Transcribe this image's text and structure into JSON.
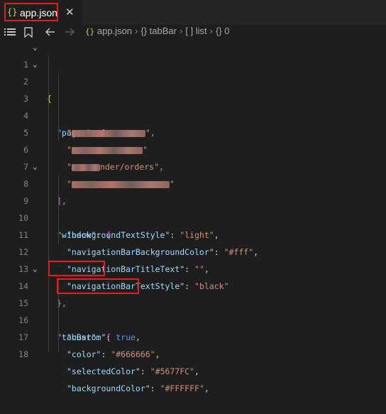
{
  "tab": {
    "icon": "json-braces-icon",
    "braces": "{}",
    "title": "app.json",
    "close_glyph": "✕"
  },
  "breadcrumb": {
    "file_icon": "{}",
    "file": "app.json",
    "items": [
      "{} tabBar",
      "[ ] list",
      "{} 0"
    ]
  },
  "lines": [
    {
      "n": "1"
    },
    {
      "n": "2"
    },
    {
      "n": "3"
    },
    {
      "n": "4"
    },
    {
      "n": "5"
    },
    {
      "n": "6"
    },
    {
      "n": "7"
    },
    {
      "n": "8"
    },
    {
      "n": "9"
    },
    {
      "n": "10"
    },
    {
      "n": "11"
    },
    {
      "n": "12"
    },
    {
      "n": "13"
    },
    {
      "n": "14"
    },
    {
      "n": "15"
    },
    {
      "n": "16"
    },
    {
      "n": "17"
    },
    {
      "n": "18"
    }
  ],
  "code": {
    "open_brace": "{",
    "pages_key": "\"pages\"",
    "pages_open": "[",
    "page4_tail": "nder/orders\",",
    "pages_close": "],",
    "window_key": "\"window\"",
    "window_open": "{",
    "bts_key": "\"backgroundTextStyle\"",
    "bts_val": "\"light\"",
    "nbbc_key": "\"navigationBarBackgroundColor\"",
    "nbbc_val": "\"#fff\"",
    "nbtt_key": "\"navigationBarTitleText\"",
    "nbtt_val": "\"\"",
    "nbts_key": "\"navigationBarTextStyle\"",
    "nbts_val": "\"black\"",
    "window_close": "},",
    "tabbar_key": "\"tabBar\"",
    "tabbar_open": "{",
    "custom_key": "\"custom\"",
    "custom_val": "true",
    "color_key": "\"color\"",
    "color_val": "\"#666666\"",
    "sel_key": "\"selectedColor\"",
    "sel_val": "\"#5677FC\"",
    "bg_key": "\"backgroundColor\"",
    "bg_val": "\"#FFFFFF\""
  },
  "colors": {
    "highlight_box": "#e02020",
    "editor_bg": "#1e1e1e",
    "key": "#9cdcfe",
    "string": "#ce9178",
    "boolean": "#569cd6"
  }
}
